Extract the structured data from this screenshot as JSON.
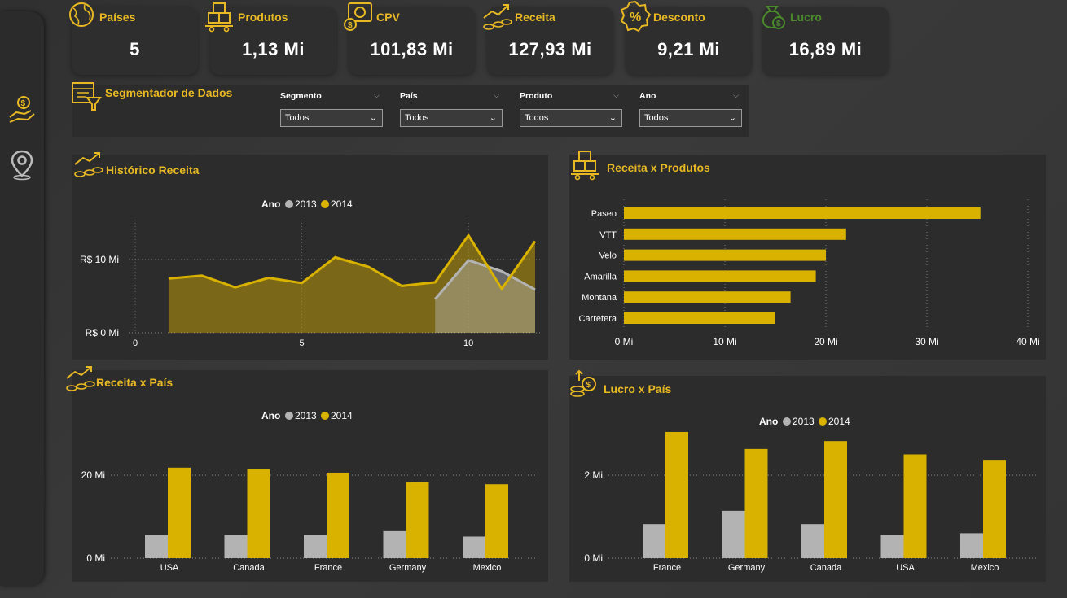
{
  "kpis": [
    {
      "title": "Países",
      "value": "5",
      "icon": "globe-hand-icon"
    },
    {
      "title": "Produtos",
      "value": "1,13 Mi",
      "icon": "boxes-cart-icon"
    },
    {
      "title": "CPV",
      "value": "101,83 Mi",
      "icon": "dollar-gear-icon"
    },
    {
      "title": "Receita",
      "value": "127,93 Mi",
      "icon": "coins-growth-icon"
    },
    {
      "title": "Desconto",
      "value": "9,21 Mi",
      "icon": "percent-badge-icon"
    },
    {
      "title": "Lucro",
      "value": "16,89 Mi",
      "icon": "money-bag-icon"
    }
  ],
  "colors": {
    "accent": "#e8b923",
    "series2013": "#b3b3b3",
    "series2014": "#d9b200",
    "lucro_title": "#4a8a2a"
  },
  "slicers": {
    "title": "Segmentador de Dados",
    "items": [
      {
        "label": "Segmento",
        "value": "Todos"
      },
      {
        "label": "País",
        "value": "Todos"
      },
      {
        "label": "Produto",
        "value": "Todos"
      },
      {
        "label": "Ano",
        "value": "Todos"
      }
    ]
  },
  "panels": {
    "historico": {
      "title": "Histórico Receita"
    },
    "produtos": {
      "title": "Receita x Produtos"
    },
    "receita_pais": {
      "title": "Receita x País"
    },
    "lucro_pais": {
      "title": "Lucro x País"
    }
  },
  "chart_data": [
    {
      "type": "area",
      "legend_title": "Ano",
      "x": [
        1,
        2,
        3,
        4,
        5,
        6,
        7,
        8,
        9,
        10,
        11,
        12
      ],
      "series": [
        {
          "name": "2013",
          "x": [
            9,
            10,
            11,
            12
          ],
          "values": [
            4.6,
            9.9,
            8.4,
            5.9
          ]
        },
        {
          "name": "2014",
          "x": [
            1,
            2,
            3,
            4,
            5,
            6,
            7,
            8,
            9,
            10,
            11,
            12
          ],
          "values": [
            7.4,
            7.8,
            6.2,
            7.5,
            6.8,
            10.3,
            9.0,
            6.4,
            6.9,
            13.3,
            6.0,
            12.5
          ]
        }
      ],
      "yticks": [
        "R$ 0 Mi",
        "R$ 10 Mi"
      ],
      "xticks": [
        "0",
        "5",
        "10"
      ],
      "xlim": [
        0,
        12
      ],
      "ylim": [
        0,
        14
      ],
      "legend": "top-center"
    },
    {
      "type": "bar",
      "orientation": "horizontal",
      "categories": [
        "Paseo",
        "VTT",
        "Velo",
        "Amarilla",
        "Montana",
        "Carretera"
      ],
      "values": [
        35.3,
        22.0,
        20.0,
        19.0,
        16.5,
        15.0
      ],
      "xticks": [
        "0 Mi",
        "10 Mi",
        "20 Mi",
        "30 Mi",
        "40 Mi"
      ],
      "xlim": [
        0,
        40
      ]
    },
    {
      "type": "bar",
      "legend_title": "Ano",
      "categories": [
        "USA",
        "Canada",
        "France",
        "Germany",
        "Mexico"
      ],
      "series": [
        {
          "name": "2013",
          "values": [
            5.6,
            5.6,
            5.6,
            6.5,
            5.2
          ]
        },
        {
          "name": "2014",
          "values": [
            21.8,
            21.5,
            20.6,
            18.4,
            17.8
          ]
        }
      ],
      "yticks": [
        "0 Mi",
        "20 Mi"
      ],
      "ylim": [
        0,
        26
      ],
      "legend": "top-center"
    },
    {
      "type": "bar",
      "legend_title": "Ano",
      "categories": [
        "France",
        "Germany",
        "Canada",
        "USA",
        "Mexico"
      ],
      "series": [
        {
          "name": "2013",
          "values": [
            0.82,
            1.14,
            0.82,
            0.56,
            0.6
          ]
        },
        {
          "name": "2014",
          "values": [
            3.04,
            2.63,
            2.82,
            2.5,
            2.37
          ]
        }
      ],
      "yticks": [
        "0 Mi",
        "2 Mi"
      ],
      "ylim": [
        0,
        3.4
      ],
      "legend": "top-center"
    }
  ]
}
